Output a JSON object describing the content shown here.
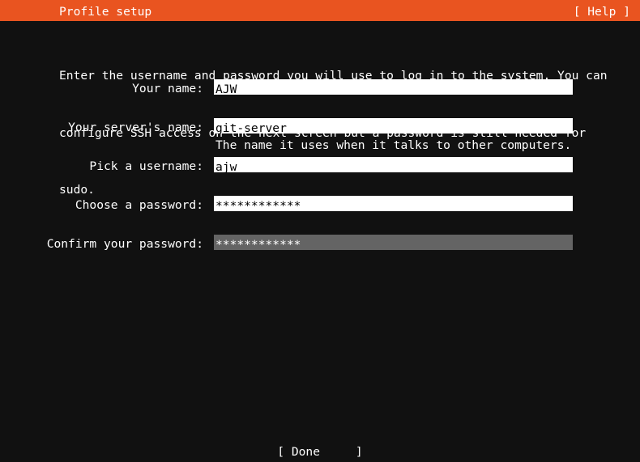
{
  "header": {
    "title": "Profile setup",
    "help_label": "[ Help ]",
    "background_color": "#E95420",
    "text_color": "#FFFFFF"
  },
  "intro": {
    "line1": "Enter the username and password you will use to log in to the system. You can",
    "line2": "configure SSH access on the next screen but a password is still needed for",
    "line3": "sudo."
  },
  "form": {
    "fields": [
      {
        "label": "Your name:",
        "value": "AJW",
        "focused": false,
        "hint": ""
      },
      {
        "label": "Your server's name:",
        "value": "git-server",
        "focused": false,
        "hint": "The name it uses when it talks to other computers."
      },
      {
        "label": "Pick a username:",
        "value": "ajw",
        "focused": false,
        "hint": ""
      },
      {
        "label": "Choose a password:",
        "value": "************",
        "focused": false,
        "hint": ""
      },
      {
        "label": "Confirm your password:",
        "value": "************",
        "focused": true,
        "hint": ""
      }
    ]
  },
  "footer": {
    "done_label": "[ Done     ]"
  },
  "colors": {
    "background": "#111111",
    "input_background": "#FFFFFF",
    "input_text": "#000000",
    "focused_input_background": "#646464",
    "focused_input_text": "#FFFFFF",
    "accent": "#E95420"
  }
}
